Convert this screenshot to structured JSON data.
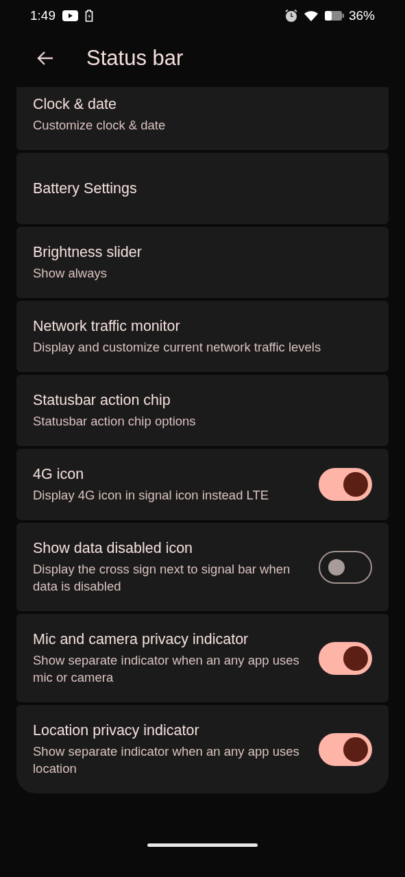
{
  "status_bar": {
    "time": "1:49",
    "battery_percent": "36%"
  },
  "header": {
    "title": "Status bar"
  },
  "items": [
    {
      "kind": "link",
      "title": "Clock & date",
      "subtitle": "Customize clock & date"
    },
    {
      "kind": "link",
      "title": "Battery Settings"
    },
    {
      "kind": "link",
      "title": "Brightness slider",
      "subtitle": "Show always"
    },
    {
      "kind": "link",
      "title": "Network traffic monitor",
      "subtitle": "Display and customize current network traffic levels"
    },
    {
      "kind": "link",
      "title": "Statusbar action chip",
      "subtitle": "Statusbar action chip options"
    },
    {
      "kind": "switch",
      "title": "4G icon",
      "subtitle": "Display 4G icon in signal icon instead LTE",
      "on": true
    },
    {
      "kind": "switch",
      "title": "Show data disabled icon",
      "subtitle": "Display the cross sign next to signal bar when data is disabled",
      "on": false
    },
    {
      "kind": "switch",
      "title": "Mic and camera privacy indicator",
      "subtitle": "Show separate indicator when an any app uses mic or camera",
      "on": true
    },
    {
      "kind": "switch",
      "title": "Location privacy indicator",
      "subtitle": "Show separate indicator when an any app uses location",
      "on": true
    }
  ]
}
